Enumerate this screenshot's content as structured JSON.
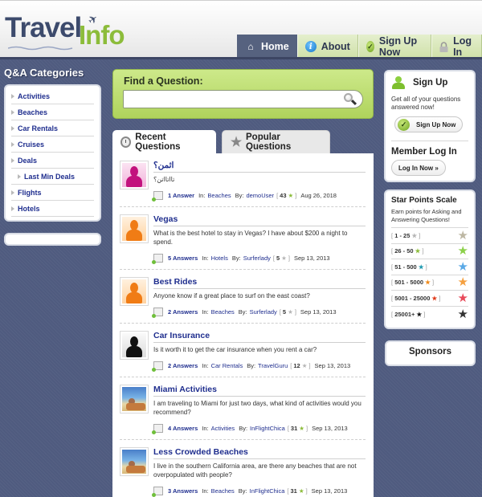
{
  "brand": {
    "name_part1": "Travel",
    "name_part2": "Info",
    "plane_glyph": "✈"
  },
  "nav": {
    "items": [
      {
        "label": "Home",
        "icon": "home-icon",
        "glyph": "⌂",
        "active": true
      },
      {
        "label": "About",
        "icon": "info-icon",
        "glyph": "i",
        "active": false
      },
      {
        "label": "Sign Up Now",
        "icon": "check-circle-icon",
        "glyph": "✓",
        "active": false
      },
      {
        "label": "Log In",
        "icon": "lock-icon",
        "glyph": "🔒",
        "active": false
      }
    ]
  },
  "categories": {
    "title": "Q&A Categories",
    "items": [
      {
        "label": "Activities",
        "sub": false
      },
      {
        "label": "Beaches",
        "sub": false
      },
      {
        "label": "Car Rentals",
        "sub": false
      },
      {
        "label": "Cruises",
        "sub": false
      },
      {
        "label": "Deals",
        "sub": false
      },
      {
        "label": "Last Min Deals",
        "sub": true
      },
      {
        "label": "Flights",
        "sub": false
      },
      {
        "label": "Hotels",
        "sub": false
      }
    ]
  },
  "search": {
    "label": "Find a Question:",
    "value": "",
    "placeholder": ""
  },
  "tabs": [
    {
      "label": "Recent Questions",
      "icon": "clock-icon",
      "active": true
    },
    {
      "label": "Popular Questions",
      "icon": "star-icon",
      "glyph": "★",
      "active": false
    }
  ],
  "questions": [
    {
      "title": "اثمن؟",
      "text": "تااتااتن؟",
      "avatar": "pink",
      "answers": "1 Answer",
      "in_label": "In:",
      "category": "Beaches",
      "by_label": "By:",
      "user": "demoUser",
      "points": "43",
      "star_color": "#8cbc3a",
      "date": "Aug 26, 2018"
    },
    {
      "title": "Vegas",
      "text": "What is the best hotel to stay in Vegas? I have about $200 a night to spend.",
      "avatar": "orange",
      "answers": "5 Answers",
      "in_label": "In:",
      "category": "Hotels",
      "by_label": "By:",
      "user": "Surferlady",
      "points": "5",
      "star_color": "#b5b5b5",
      "date": "Sep 13, 2013"
    },
    {
      "title": "Best Rides",
      "text": "Anyone know if a great place to surf on the east coast?",
      "avatar": "orange",
      "answers": "2 Answers",
      "in_label": "In:",
      "category": "Beaches",
      "by_label": "By:",
      "user": "Surferlady",
      "points": "5",
      "star_color": "#b5b5b5",
      "date": "Sep 13, 2013"
    },
    {
      "title": "Car Insurance",
      "text": "Is it worth it to get the car insurance when you rent a car?",
      "avatar": "black",
      "answers": "2 Answers",
      "in_label": "In:",
      "category": "Car Rentals",
      "by_label": "By:",
      "user": "TravelGuru",
      "points": "12",
      "star_color": "#b5b5b5",
      "date": "Sep 13, 2013"
    },
    {
      "title": "Miami Activities",
      "text": "I am traveling to Miami for just two days, what kind of activities would you recommend?",
      "avatar": "beach",
      "answers": "4 Answers",
      "in_label": "In:",
      "category": "Activities",
      "by_label": "By:",
      "user": "InFlightChica",
      "points": "31",
      "star_color": "#8cbc3a",
      "date": "Sep 13, 2013"
    },
    {
      "title": "Less Crowded Beaches",
      "text": "I live in the southern California area, are there any beaches that are not overpopulated with people?",
      "avatar": "beach",
      "answers": "3 Answers",
      "in_label": "In:",
      "category": "Beaches",
      "by_label": "By:",
      "user": "InFlightChica",
      "points": "31",
      "star_color": "#8cbc3a",
      "date": "Sep 13, 2013"
    }
  ],
  "signup": {
    "title": "Sign Up",
    "text": "Get all of your questions answered now!",
    "button": "Sign Up Now",
    "login_title": "Member Log In",
    "login_button": "Log In Now »"
  },
  "star_scale": {
    "title": "Star Points Scale",
    "text": "Earn points for Asking and Answering Questions!",
    "levels": [
      {
        "range": "1 - 25",
        "color": "#b5b5b5",
        "big_color": "#bdb7a3"
      },
      {
        "range": "26 - 50",
        "color": "#8cbc3a",
        "big_color": "#8cd04a"
      },
      {
        "range": "51 - 500",
        "color": "#1f9ab0",
        "big_color": "#5aa9e6"
      },
      {
        "range": "501 - 5000",
        "color": "#f08a1a",
        "big_color": "#f5a040"
      },
      {
        "range": "5001 - 25000",
        "color": "#e03a1a",
        "big_color": "#e84a5a"
      },
      {
        "range": "25001+",
        "color": "#111111",
        "big_color": "#333333"
      }
    ]
  },
  "sponsors": {
    "title": "Sponsors"
  }
}
